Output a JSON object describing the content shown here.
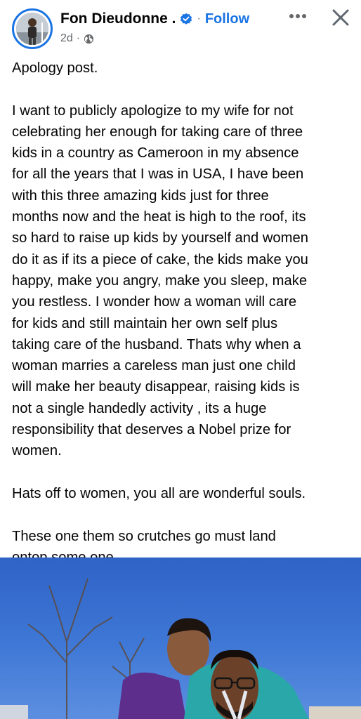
{
  "header": {
    "author_name": "Fon Dieudonne .",
    "follow_label": "Follow",
    "separator": "·",
    "time": "2d",
    "audience_icon": "globe-icon",
    "verified_icon": "verified-badge-icon",
    "more_icon": "more-options-icon",
    "close_icon": "close-icon"
  },
  "post": {
    "lines": [
      "Apology post.",
      "",
      "I want to publicly apologize to my wife for not",
      "celebrating her enough for taking care of three",
      "kids in a country as Cameroon in my absence",
      "for all the years that I was in USA, I have been",
      "with this three amazing kids just for three",
      "months now and the heat is high to the roof, its",
      "so hard to raise up kids by yourself and women",
      "do it as if its a piece of cake, the kids make you",
      "happy, make you angry, make you sleep, make",
      "you restless.  I wonder how a woman will care",
      "for kids and still maintain her own self plus",
      "taking care of the husband.  Thats why when a",
      "woman marries a careless man just one child",
      "will make her beauty disappear,  raising kids is",
      "not a single handedly activity , its a huge",
      "responsibility that deserves a Nobel prize for",
      "women.",
      "",
      "Hats off to women, you all are wonderful souls.",
      "",
      "These one them so crutches go must land",
      "ontop some one ."
    ]
  },
  "colors": {
    "accent": "#1b74e4",
    "text": "#050505",
    "secondary_text": "#65676b"
  }
}
